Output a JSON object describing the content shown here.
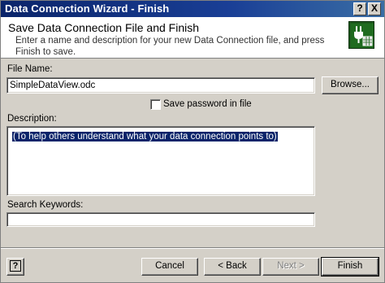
{
  "window": {
    "title": "Data Connection Wizard - Finish",
    "help_label": "?",
    "close_label": "X"
  },
  "header": {
    "title": "Save Data Connection File and Finish",
    "description": "Enter a name and description for your new Data Connection file, and press Finish to save."
  },
  "file_name": {
    "label": "File Name:",
    "value": "SimpleDataView.odc"
  },
  "browse_label": "Browse...",
  "save_password": {
    "label": "Save password in file",
    "checked": false
  },
  "description": {
    "label": "Description:",
    "value": "(To help others understand what your data connection points to)"
  },
  "search_keywords": {
    "label": "Search Keywords:",
    "value": ""
  },
  "footer": {
    "help_label": "?",
    "cancel_label": "Cancel",
    "back_label": "< Back",
    "next_label": "Next >",
    "finish_label": "Finish"
  }
}
